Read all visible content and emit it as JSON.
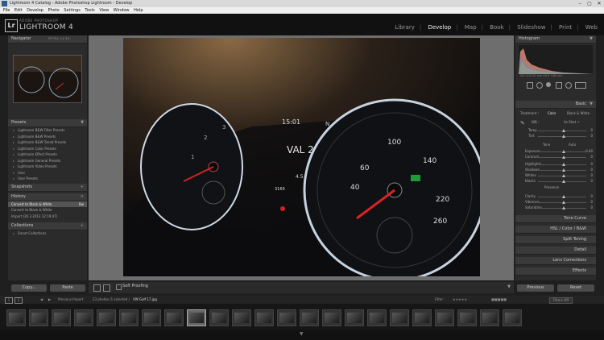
{
  "window": {
    "title": "Lightroom 4 Catalog - Adobe Photoshop Lightroom - Develop",
    "controls": [
      "–",
      "▢",
      "✕"
    ]
  },
  "menu": [
    "File",
    "Edit",
    "Develop",
    "Photo",
    "Settings",
    "Tools",
    "View",
    "Window",
    "Help"
  ],
  "identity": {
    "logo": "Lr",
    "vendor": "ADOBE PHOTOSHOP",
    "product": "LIGHTROOM 4"
  },
  "modules": [
    "Library",
    "Develop",
    "Map",
    "Book",
    "Slideshow",
    "Print",
    "Web"
  ],
  "active_module": "Develop",
  "left": {
    "navigator": {
      "title": "Navigator",
      "zoom": [
        "FIT",
        "FILL",
        "1:1",
        "3:1"
      ]
    },
    "presets": {
      "title": "Presets",
      "items": [
        "Lightroom B&W Filter Presets",
        "Lightroom B&W Presets",
        "Lightroom B&W Toned Presets",
        "Lightroom Color Presets",
        "Lightroom Effect Presets",
        "Lightroom General Presets",
        "Lightroom Video Presets",
        "User",
        "User Presets"
      ]
    },
    "snapshots": {
      "title": "Snapshots"
    },
    "history": {
      "title": "History",
      "items": [
        {
          "label": "Convert to Black & White",
          "value": "Bw"
        },
        {
          "label": "Convert to Black & White",
          "value": ""
        },
        {
          "label": "Import (20.3.2013 12:19:47)",
          "value": ""
        }
      ]
    },
    "collections": {
      "title": "Collections",
      "items": [
        "Smart Collections"
      ]
    },
    "copy": "Copy...",
    "paste": "Paste"
  },
  "toolbar": {
    "soft_proofing": "Soft Proofing"
  },
  "right": {
    "histogram": {
      "title": "Histogram",
      "info": "ISO 200    22 mm    f/4.5    1/60 sec"
    },
    "basic": {
      "title": "Basic",
      "treatment_label": "Treatment :",
      "treatment": [
        "Color",
        "Black & White"
      ],
      "wb_label": "WB :",
      "wb_value": "As Shot ÷",
      "rows": [
        {
          "label": "Temp",
          "value": "0"
        },
        {
          "label": "Tint",
          "value": "0"
        }
      ],
      "tone_label": "Tone",
      "tone_auto": "Auto",
      "tone_rows": [
        {
          "label": "Exposure",
          "value": "0.00"
        },
        {
          "label": "Contrast",
          "value": "0"
        },
        {
          "label": "Highlights",
          "value": "0"
        },
        {
          "label": "Shadows",
          "value": "0"
        },
        {
          "label": "Whites",
          "value": "0"
        },
        {
          "label": "Blacks",
          "value": "0"
        }
      ],
      "presence_label": "Presence",
      "presence_rows": [
        {
          "label": "Clarity",
          "value": "0"
        },
        {
          "label": "Vibrance",
          "value": "0"
        },
        {
          "label": "Saturation",
          "value": "0"
        }
      ]
    },
    "sections": [
      "Tone Curve",
      "HSL / Color / B&W",
      "Split Toning",
      "Detail",
      "Lens Corrections",
      "Effects"
    ],
    "previous": "Previous",
    "reset": "Reset"
  },
  "filmstrip": {
    "pages": [
      "1",
      "2"
    ],
    "source": "Previous Import",
    "count": "23 photos /1 selected /",
    "filename": "VW Golf 17.jpg",
    "filter_label": "Filter :",
    "filter_value": "Filters Off",
    "selected_index": 8
  },
  "photo": {
    "clock": "15:01",
    "compass": "N",
    "display": "VAL 202",
    "odo": "3169",
    "trip": "4.5"
  }
}
